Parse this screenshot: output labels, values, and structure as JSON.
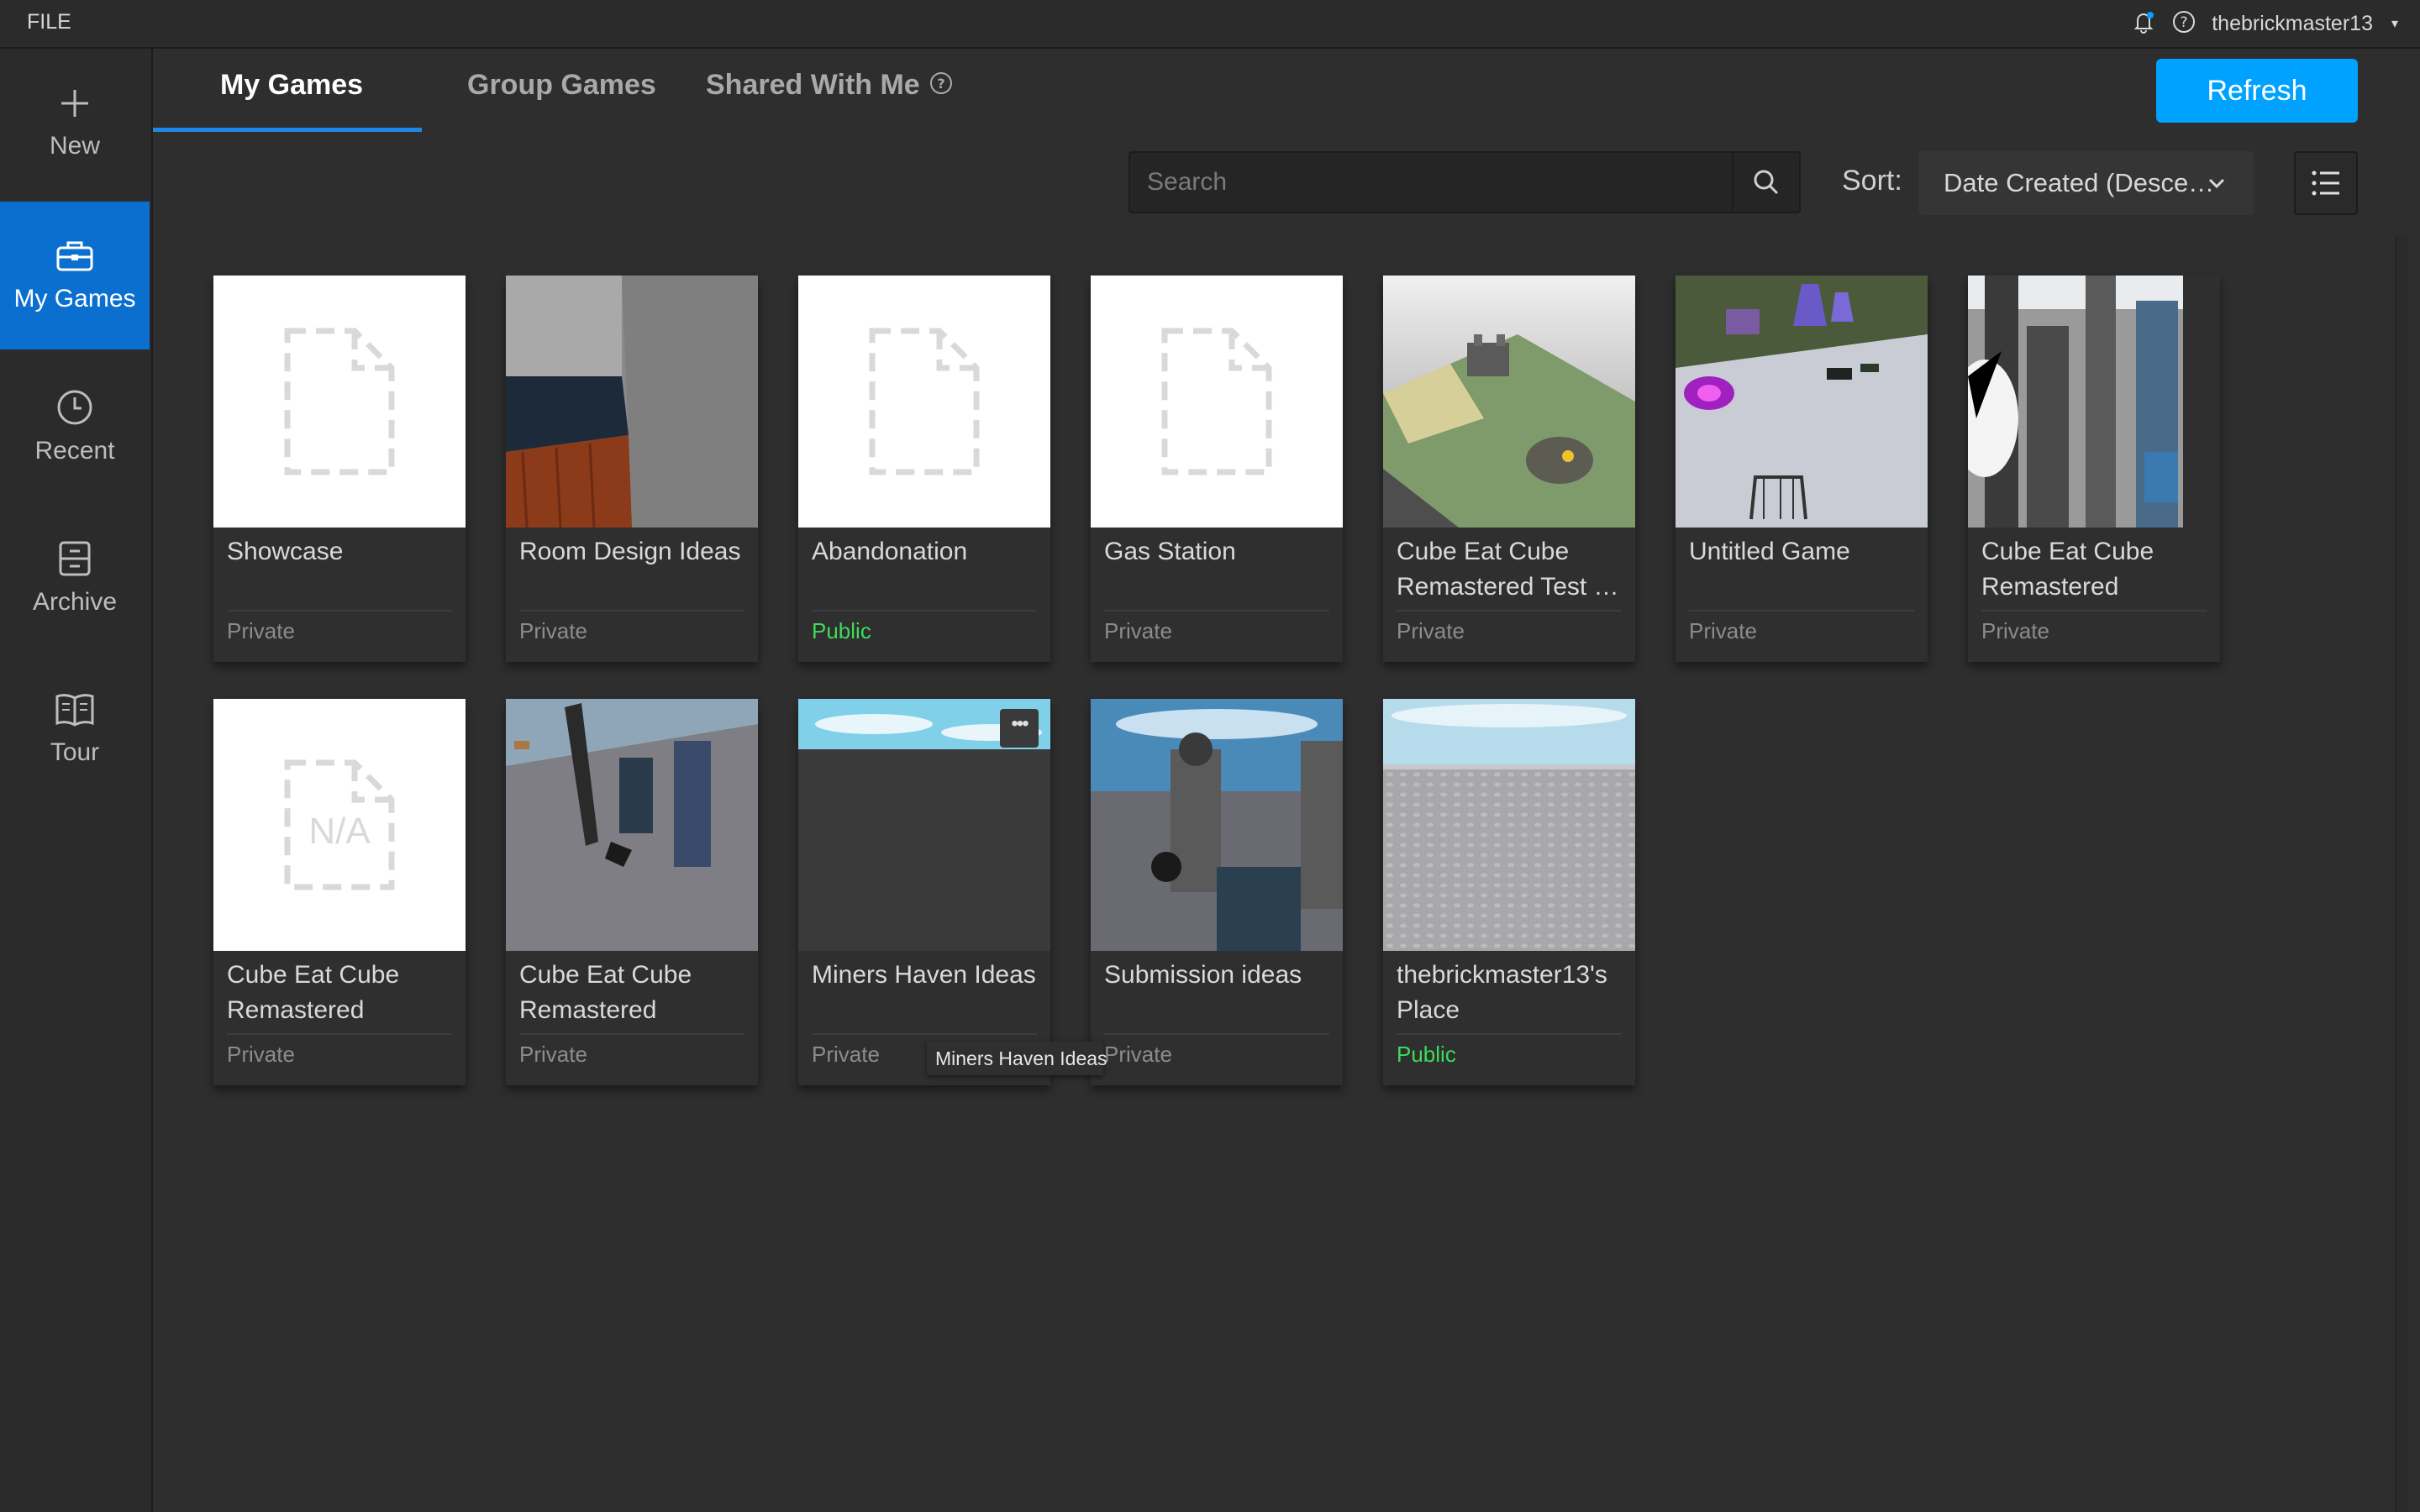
{
  "menu": {
    "file": "FILE",
    "username": "thebrickmaster13",
    "notification_icon": "bell-icon",
    "help_icon": "help-icon"
  },
  "sidebar": {
    "items": [
      {
        "label": "New",
        "icon": "plus-icon"
      },
      {
        "label": "My Games",
        "icon": "briefcase-icon",
        "active": true
      },
      {
        "label": "Recent",
        "icon": "clock-icon"
      },
      {
        "label": "Archive",
        "icon": "archive-icon"
      },
      {
        "label": "Tour",
        "icon": "book-icon"
      }
    ]
  },
  "tabs": [
    {
      "label": "My Games",
      "active": true
    },
    {
      "label": "Group Games"
    },
    {
      "label": "Shared With Me"
    }
  ],
  "toolbar": {
    "refresh_label": "Refresh",
    "search_placeholder": "Search",
    "sort_label": "Sort:",
    "sort_value": "Date Created (Desce…"
  },
  "colors": {
    "accent": "#00a2ff",
    "active_sidebar": "#0b6fcf",
    "public_status": "#3ddc5a"
  },
  "games": [
    {
      "title": "Showcase",
      "status": "Private",
      "thumbnail": "placeholder-file"
    },
    {
      "title": "Room Design Ideas",
      "status": "Private",
      "thumbnail": "room-render"
    },
    {
      "title": "Abandonation",
      "status": "Public",
      "thumbnail": "placeholder-file"
    },
    {
      "title": "Gas Station",
      "status": "Private",
      "thumbnail": "placeholder-file"
    },
    {
      "title": "Cube Eat Cube Remastered Test …",
      "status": "Private",
      "thumbnail": "island-render"
    },
    {
      "title": "Untitled Game",
      "status": "Private",
      "thumbnail": "arena-render"
    },
    {
      "title": "Cube Eat Cube Remastered",
      "status": "Private",
      "thumbnail": "city-render"
    },
    {
      "title": "Cube Eat Cube Remastered",
      "status": "Private",
      "thumbnail": "placeholder-na",
      "na_text": "N/A"
    },
    {
      "title": "Cube Eat Cube Remastered",
      "status": "Private",
      "thumbnail": "towers-render"
    },
    {
      "title": "Miners Haven Ideas",
      "status": "Private",
      "thumbnail": "dark-baseplate",
      "tooltip": "Miners Haven Ideas"
    },
    {
      "title": "Submission ideas",
      "status": "Private",
      "thumbnail": "statues-render"
    },
    {
      "title": "thebrickmaster13's Place",
      "status": "Public",
      "thumbnail": "baseplate-render"
    }
  ]
}
